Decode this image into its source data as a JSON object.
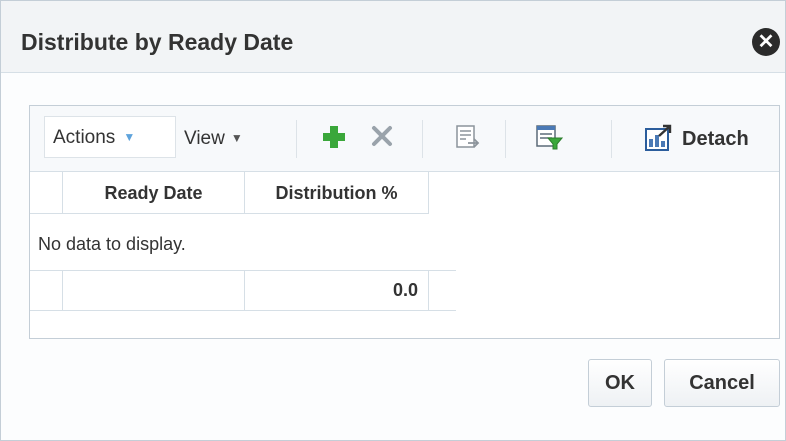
{
  "dialog": {
    "title": "Distribute by Ready Date",
    "close_icon": "close-icon"
  },
  "toolbar": {
    "actions_label": "Actions",
    "view_label": "View",
    "add_icon": "plus-icon",
    "delete_icon": "delete-icon",
    "export_icon": "export-icon",
    "filter_icon": "query-filter-icon",
    "detach_icon": "detach-icon",
    "detach_label": "Detach"
  },
  "table": {
    "columns": [
      "Ready Date",
      "Distribution %"
    ],
    "empty_message": "No data to display.",
    "total_value": "0.0"
  },
  "buttons": {
    "ok": "OK",
    "cancel": "Cancel"
  },
  "colors": {
    "accent_green": "#3aa73a",
    "caret_blue": "#5ea3dc",
    "header_bg": "#f2f4f6"
  }
}
